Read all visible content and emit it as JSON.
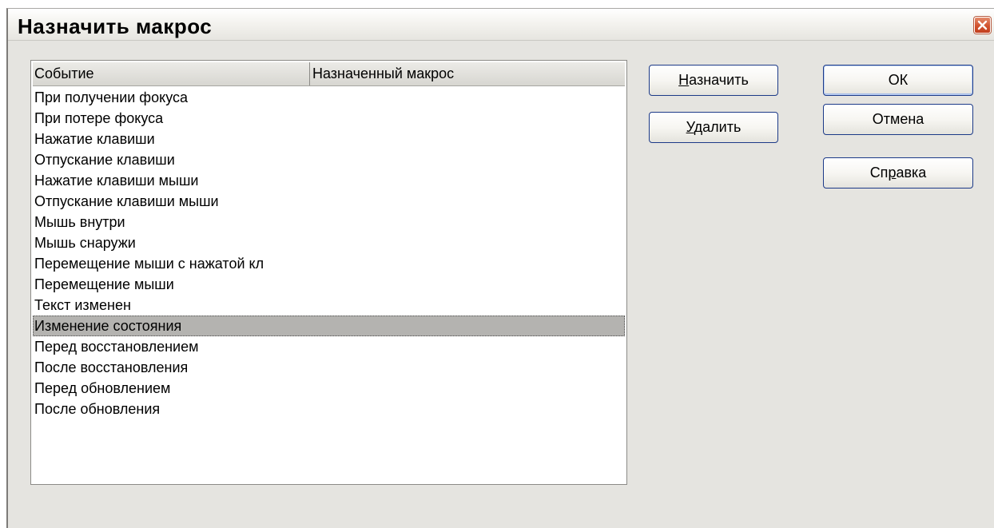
{
  "window": {
    "title": "Назначить макрос"
  },
  "list": {
    "columns": [
      "Событие",
      "Назначенный макрос"
    ],
    "rows": [
      {
        "event": "При получении фокуса",
        "macro": ""
      },
      {
        "event": "При потере фокуса",
        "macro": ""
      },
      {
        "event": "Нажатие клавиши",
        "macro": ""
      },
      {
        "event": "Отпускание клавиши",
        "macro": ""
      },
      {
        "event": "Нажатие клавиши мыши",
        "macro": ""
      },
      {
        "event": "Отпускание клавиши мыши",
        "macro": ""
      },
      {
        "event": "Мышь внутри",
        "macro": ""
      },
      {
        "event": "Мышь снаружи",
        "macro": ""
      },
      {
        "event": "Перемещение мыши с нажатой кл",
        "macro": ""
      },
      {
        "event": "Перемещение мыши",
        "macro": ""
      },
      {
        "event": "Текст изменен",
        "macro": ""
      },
      {
        "event": "Изменение состояния",
        "macro": ""
      },
      {
        "event": "Перед восстановлением",
        "macro": ""
      },
      {
        "event": "После восстановления",
        "macro": ""
      },
      {
        "event": "Перед обновлением",
        "macro": ""
      },
      {
        "event": "После обновления",
        "macro": ""
      }
    ],
    "selected_index": 11
  },
  "buttons": {
    "assign": {
      "accel": "Н",
      "rest": "азначить"
    },
    "delete": {
      "accel": "У",
      "rest": "далить"
    },
    "ok": "ОК",
    "cancel": "Отмена",
    "help": {
      "pre": "Сп",
      "accel": "р",
      "rest": "авка"
    }
  },
  "colors": {
    "selection": "#b4b3b0",
    "button_border": "#1c3a88",
    "dialog_bg": "#e5e4e0",
    "close_button": "#d1522e"
  },
  "icons": {
    "close": "close-x-icon"
  }
}
